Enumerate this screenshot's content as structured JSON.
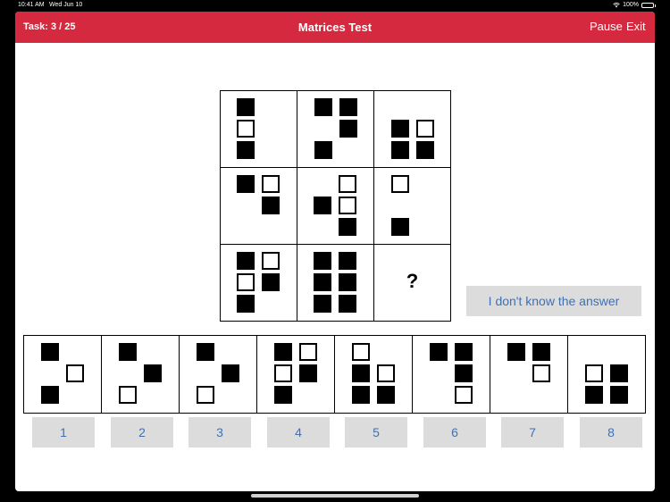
{
  "status": {
    "time": "10:41 AM",
    "date": "Wed Jun 10",
    "battery": "100%"
  },
  "header": {
    "task": "Task: 3 / 25",
    "title": "Matrices Test",
    "pause": "Pause",
    "exit": "Exit"
  },
  "matrix": {
    "missing_symbol": "?"
  },
  "dont_know_label": "I don't know the answer",
  "option_labels": [
    "1",
    "2",
    "3",
    "4",
    "5",
    "6",
    "7",
    "8"
  ],
  "colors": {
    "header": "#D4293F",
    "button_bg": "#DCDCDC",
    "button_text": "#3F71B5"
  }
}
